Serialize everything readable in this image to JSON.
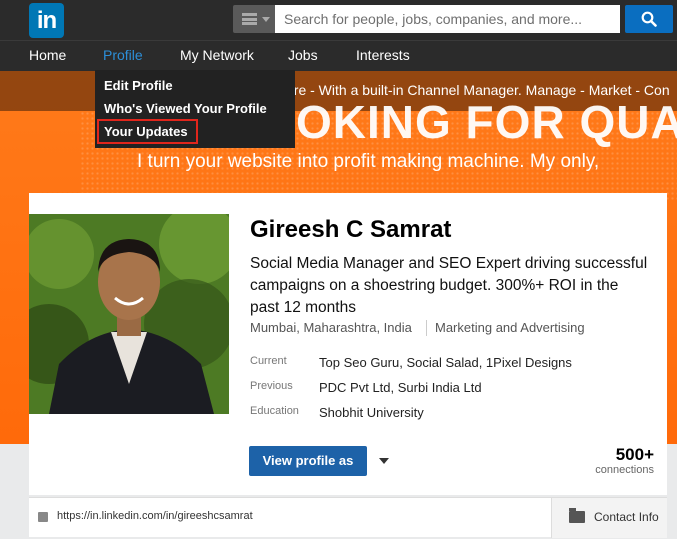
{
  "brand": {
    "logo_text": "in"
  },
  "search": {
    "placeholder": "Search for people, jobs, companies, and more..."
  },
  "nav": {
    "home": "Home",
    "profile": "Profile",
    "my_network": "My Network",
    "jobs": "Jobs",
    "interests": "Interests"
  },
  "profile_menu": {
    "items": [
      "Edit Profile",
      "Who's Viewed Your Profile",
      "Your Updates"
    ]
  },
  "banner": {
    "strip_text": "are - With a built-in Channel Manager. Manage - Market - Con",
    "headline": "OKING FOR QUALITY T",
    "subtitle": "I turn your website into profit making machine. My only,"
  },
  "profile": {
    "name": "Gireesh C Samrat",
    "headline": "Social Media Manager and SEO Expert driving successful campaigns on a shoestring budget. 300%+ ROI in the past 12 months",
    "location": "Mumbai, Maharashtra, India",
    "industry": "Marketing and Advertising",
    "facts": [
      {
        "label": "Current",
        "value": "Top Seo Guru, Social Salad, 1Pixel Designs"
      },
      {
        "label": "Previous",
        "value": "PDC Pvt Ltd, Surbi India Ltd"
      },
      {
        "label": "Education",
        "value": "Shobhit University"
      }
    ],
    "view_button": "View profile as",
    "connections_count": "500+",
    "connections_label": "connections",
    "public_url": "https://in.linkedin.com/in/gireeshcsamrat",
    "contact_info": "Contact Info"
  },
  "colors": {
    "accent": "#0077b5",
    "nav_active": "#2c8fd8",
    "banner_orange": "#ff6a0a",
    "highlight_border": "#e1261c"
  },
  "icons": [
    "logo-icon",
    "menu-icon",
    "search-icon",
    "chevron-down-icon",
    "linkedin-small-icon",
    "folder-icon"
  ]
}
